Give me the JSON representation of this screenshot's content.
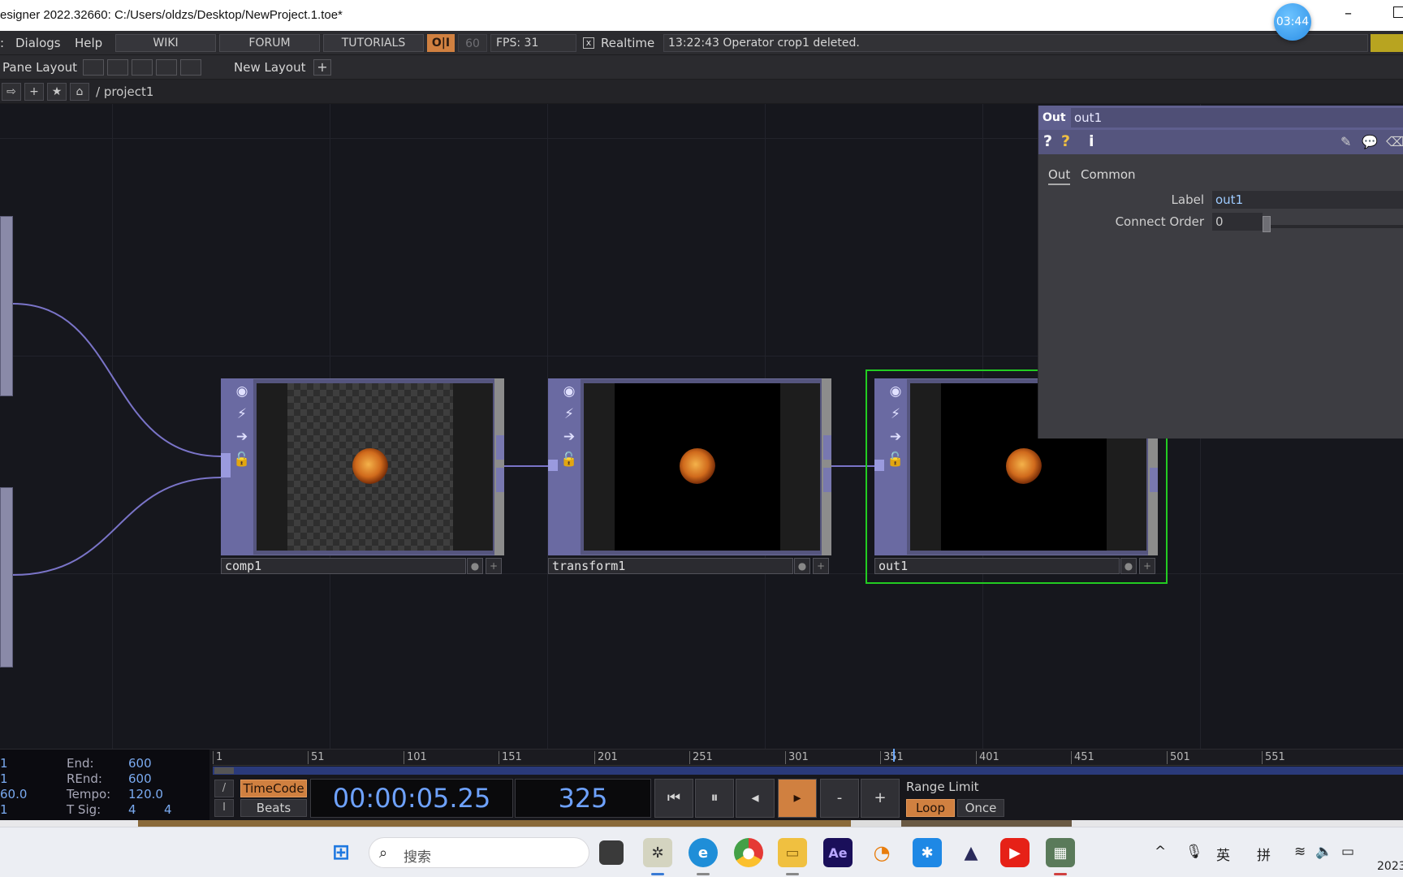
{
  "window": {
    "title": "esigner 2022.32660: C:/Users/oldzs/Desktop/NewProject.1.toe*",
    "recorder_time": "03:44",
    "minimize": "–"
  },
  "menu": {
    "dialogs": "Dialogs",
    "help": "Help",
    "wiki": "WIKI",
    "forum": "FORUM",
    "tutorials": "TUTORIALS",
    "oi": "O|I",
    "fps_target": "60",
    "fps": "FPS:  31",
    "realtime_check": "x",
    "realtime": "Realtime",
    "status": "13:22:43 Operator crop1 deleted."
  },
  "pane": {
    "label": "Pane Layout",
    "new_layout": "New Layout",
    "plus": "+"
  },
  "pathbar": {
    "path": "/ project1",
    "btn_forward": "⇨",
    "btn_add": "+",
    "btn_star": "★",
    "btn_home": "⌂"
  },
  "nodes": [
    {
      "name": "comp1"
    },
    {
      "name": "transform1"
    },
    {
      "name": "out1"
    }
  ],
  "node_icons": {
    "view": "◉",
    "cook": "⚡",
    "export": "➔",
    "lock": "🔓",
    "flag_add": "+"
  },
  "params": {
    "op_type": "Out",
    "op_name": "out1",
    "help": "?",
    "python_help": "?",
    "info": "i",
    "tabs": [
      "Out",
      "Common"
    ],
    "label_label": "Label",
    "label_value": "out1",
    "connect_order_label": "Connect Order",
    "connect_order_value": "0"
  },
  "timeline": {
    "start_label": "1",
    "start2": "1",
    "rate": "60.0",
    "start3": "1",
    "end_label": "End:",
    "end_value": "600",
    "rend_label": "REnd:",
    "rend_value": "600",
    "tempo_label": "Tempo:",
    "tempo_value": "120.0",
    "tsig_label": "T Sig:",
    "tsig_a": "4",
    "tsig_b": "4",
    "ruler": [
      "1",
      "51",
      "101",
      "151",
      "201",
      "251",
      "301",
      "351",
      "401",
      "451",
      "501",
      "551"
    ],
    "timecode_btn": "TimeCode",
    "beats_btn": "Beats",
    "timecode": "00:00:05.25",
    "frame": "325",
    "btn_start": "⏮",
    "btn_pause": "⏸",
    "btn_back": "◂",
    "btn_play": "▸",
    "btn_minus": "-",
    "btn_plus": "+",
    "range_limit": "Range Limit",
    "loop": "Loop",
    "once": "Once",
    "slash": "/",
    "bar": "I"
  },
  "taskbar": {
    "search_placeholder": "搜索",
    "ime_en": "英",
    "ime_pin": "拼",
    "clock": "2023"
  }
}
